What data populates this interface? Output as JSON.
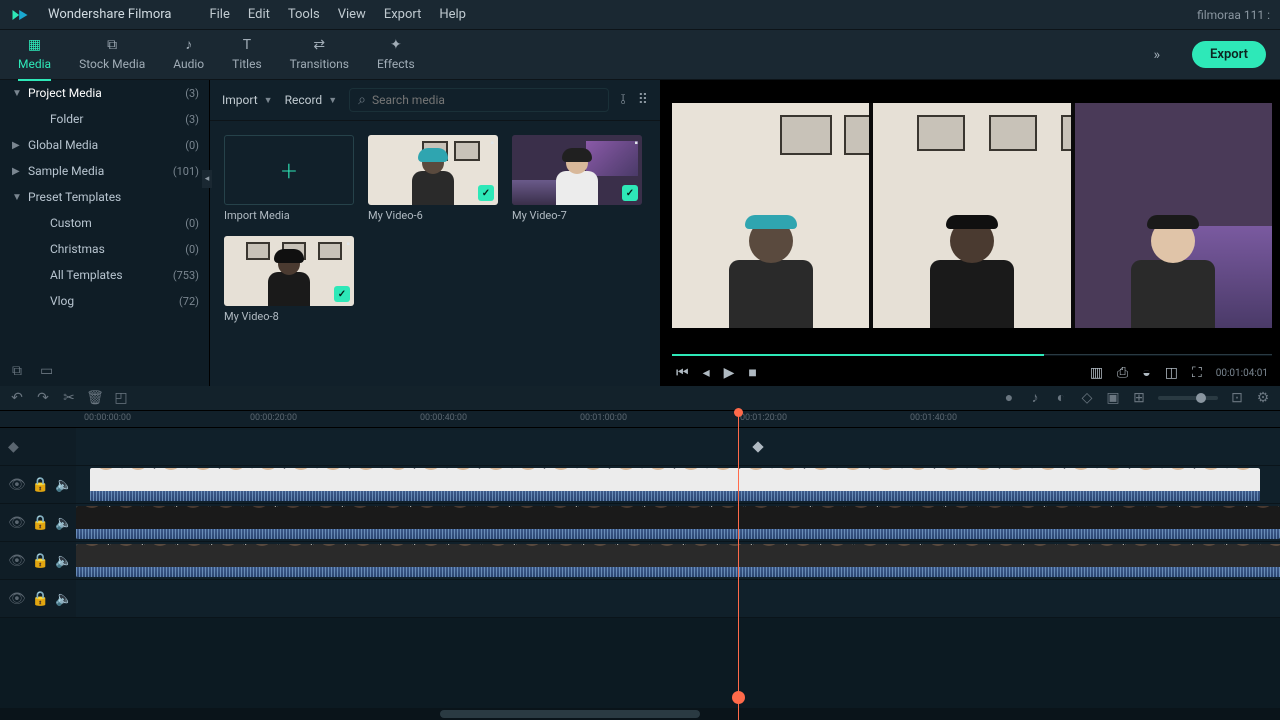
{
  "app_title": "Wondershare Filmora",
  "project_name": "filmoraa 111 :",
  "menu": [
    "File",
    "Edit",
    "Tools",
    "View",
    "Export",
    "Help"
  ],
  "tabs": [
    {
      "label": "Media",
      "name": "media"
    },
    {
      "label": "Stock Media",
      "name": "stock-media"
    },
    {
      "label": "Audio",
      "name": "audio"
    },
    {
      "label": "Titles",
      "name": "titles"
    },
    {
      "label": "Transitions",
      "name": "transitions"
    },
    {
      "label": "Effects",
      "name": "effects"
    }
  ],
  "export_label": "Export",
  "tree": [
    {
      "label": "Project Media",
      "count": "(3)",
      "level": 0,
      "caret": "▼",
      "active": true
    },
    {
      "label": "Folder",
      "count": "(3)",
      "level": 1,
      "caret": ""
    },
    {
      "label": "Global Media",
      "count": "(0)",
      "level": 0,
      "caret": "▶"
    },
    {
      "label": "Sample Media",
      "count": "(101)",
      "level": 0,
      "caret": "▶"
    },
    {
      "label": "Preset Templates",
      "count": "",
      "level": 0,
      "caret": "▼"
    },
    {
      "label": "Custom",
      "count": "(0)",
      "level": 1,
      "caret": ""
    },
    {
      "label": "Christmas",
      "count": "(0)",
      "level": 1,
      "caret": ""
    },
    {
      "label": "All Templates",
      "count": "(753)",
      "level": 1,
      "caret": ""
    },
    {
      "label": "Vlog",
      "count": "(72)",
      "level": 1,
      "caret": ""
    }
  ],
  "import_label": "Import",
  "record_label": "Record",
  "search_placeholder": "Search media",
  "import_media_label": "Import Media",
  "clips": [
    {
      "name": "My Video-6",
      "id": "v6"
    },
    {
      "name": "My Video-7",
      "id": "v7"
    },
    {
      "name": "My Video-8",
      "id": "v8"
    }
  ],
  "preview_timecode": "00:01:04:01",
  "ruler_ticks": [
    "00:00:00:00",
    "00:00:20:00",
    "00:00:40:00",
    "00:01:00:00",
    "00:01:20:00",
    "00:01:40:00"
  ],
  "colors": {
    "accent": "#2ee8b8",
    "playhead": "#ff6a4a"
  },
  "scenes": {
    "v6": {
      "wall": "#e8e2d8",
      "frames": [
        [
          54,
          6,
          26,
          20
        ],
        [
          86,
          6,
          26,
          20
        ]
      ],
      "head": "#5a4a3e",
      "hair": "#2fa5b0",
      "body": "#2a2a2a"
    },
    "v7": {
      "wall": "#3a2f4a",
      "frames": [],
      "head": "#d8b89a",
      "hair": "#202020",
      "body": "#ececec",
      "deskL": true
    },
    "v8": {
      "wall": "#e6e0d6",
      "frames": [
        [
          22,
          6,
          24,
          18
        ],
        [
          58,
          6,
          24,
          18
        ],
        [
          94,
          6,
          24,
          18
        ]
      ],
      "head": "#4a3a30",
      "hair": "#101010",
      "body": "#1a1a1a"
    },
    "p3": {
      "wall": "#4a3a58",
      "frames": [],
      "head": "#e0c4a8",
      "hair": "#1a1a1a",
      "body": "#2a2a2a",
      "deskR": true
    }
  }
}
